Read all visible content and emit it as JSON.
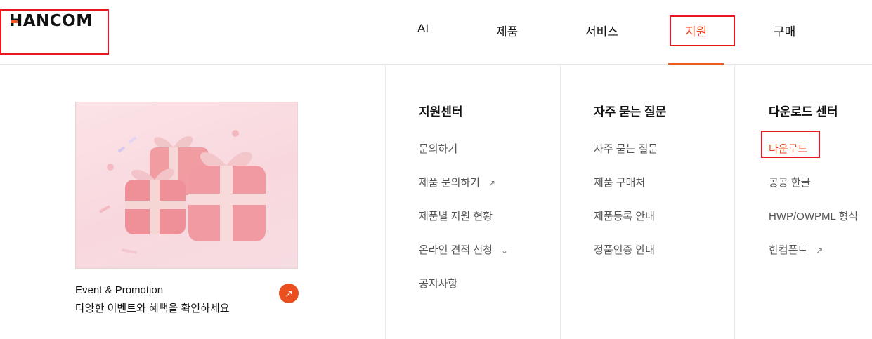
{
  "brand": {
    "logo_text": "HANCOM"
  },
  "nav": {
    "items": [
      "AI",
      "제품",
      "서비스",
      "지원",
      "구매"
    ]
  },
  "promo": {
    "title": "Event & Promotion",
    "subtitle": "다양한 이벤트와 혜택을 확인하세요",
    "button_icon": "arrow-up-right-icon"
  },
  "columns": [
    {
      "title": "지원센터",
      "links": [
        "문의하기",
        "제품 문의하기",
        "제품별 지원 현황",
        "온라인 견적 신청",
        "공지사항"
      ]
    },
    {
      "title": "자주 묻는 질문",
      "links": [
        "자주 묻는 질문",
        "제품 구매처",
        "제품등록 안내",
        "정품인증 안내"
      ]
    },
    {
      "title": "다운로드 센터",
      "links": [
        "다운로드",
        "공공 한글",
        "HWP/OWPML 형식",
        "한컴폰트"
      ]
    }
  ],
  "icons": {
    "external": "↗",
    "chevron": "⌄"
  },
  "colors": {
    "accent": "#e8451f",
    "highlight_box": "#e8171f"
  }
}
